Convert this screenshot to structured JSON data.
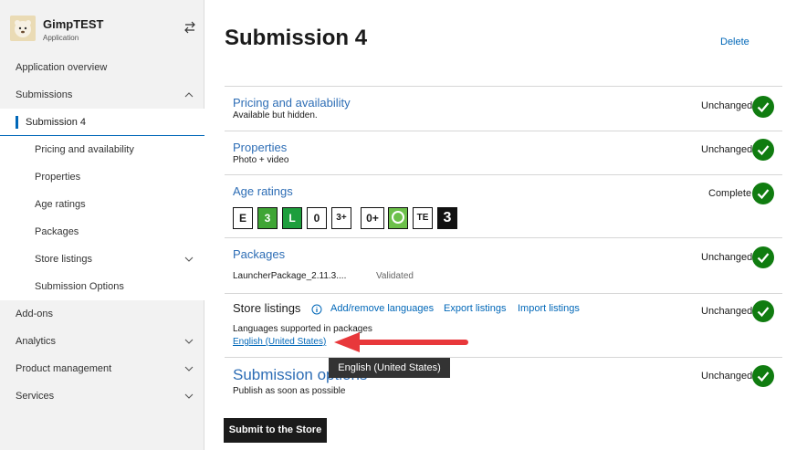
{
  "app": {
    "name": "GimpTEST",
    "type": "Application"
  },
  "sidebar": {
    "items": [
      {
        "label": "Application overview"
      },
      {
        "label": "Submissions"
      },
      {
        "label": "Submission 4"
      },
      {
        "label": "Pricing and availability"
      },
      {
        "label": "Properties"
      },
      {
        "label": "Age ratings"
      },
      {
        "label": "Packages"
      },
      {
        "label": "Store listings"
      },
      {
        "label": "Submission Options"
      },
      {
        "label": "Add-ons"
      },
      {
        "label": "Analytics"
      },
      {
        "label": "Product management"
      },
      {
        "label": "Services"
      }
    ]
  },
  "main": {
    "title": "Submission 4",
    "delete_label": "Delete",
    "sections": [
      {
        "title": "Pricing and availability",
        "subtitle": "Available but hidden.",
        "status": "Unchanged"
      },
      {
        "title": "Properties",
        "subtitle": "Photo + video",
        "status": "Unchanged"
      },
      {
        "title": "Age ratings",
        "subtitle": "",
        "status": "Complete"
      },
      {
        "title": "Packages",
        "package_name": "LauncherPackage_2.11.3....",
        "package_state": "Validated",
        "status": "Unchanged"
      },
      {
        "title": "Store listings",
        "add_remove": "Add/remove languages",
        "export": "Export listings",
        "import": "Import listings",
        "langs_label": "Languages supported in packages",
        "lang_link": "English (United States)",
        "status": "Unchanged"
      },
      {
        "title": "Submission options",
        "subtitle": "Publish as soon as possible",
        "status": "Unchanged"
      }
    ],
    "age_badges": [
      "E",
      "3",
      "L",
      "0",
      "3+",
      "0+",
      "",
      "TE",
      "3"
    ],
    "tooltip": "English (United States)",
    "submit_label": "Submit to the Store"
  },
  "colors": {
    "accent": "#0067b8",
    "check": "#107c10",
    "arrow": "#e8383b"
  }
}
